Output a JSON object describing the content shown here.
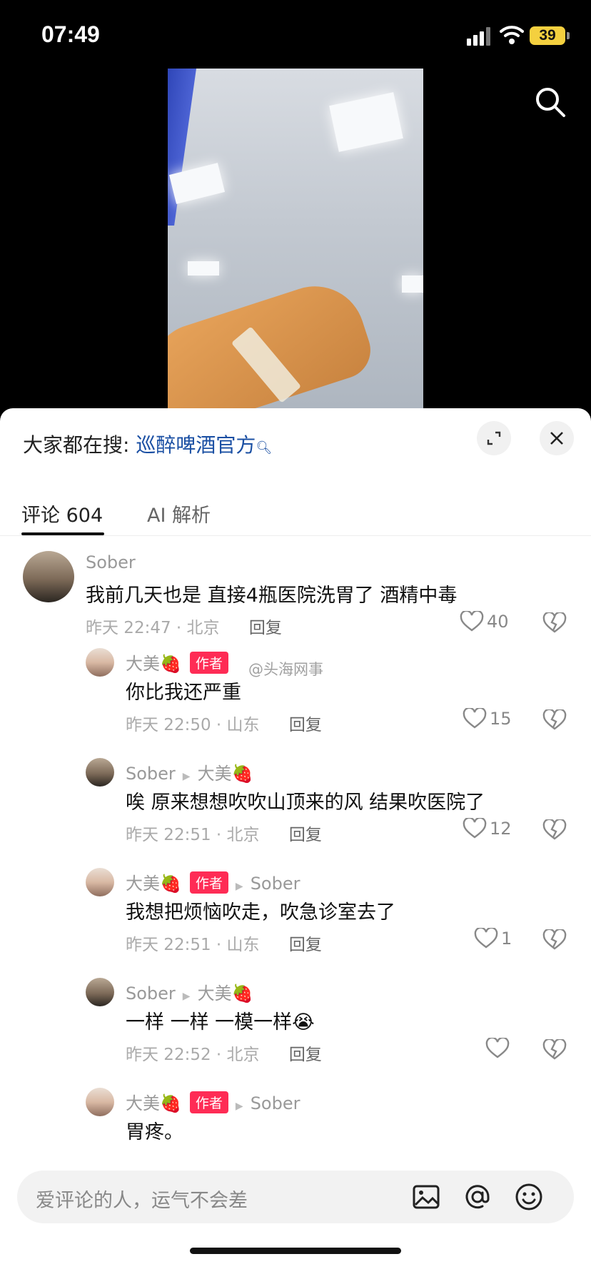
{
  "status_bar": {
    "time": "07:49",
    "battery": "39"
  },
  "hot_search": {
    "prefix": "大家都在搜:",
    "keyword": "巡醉啤酒官方"
  },
  "tabs": [
    {
      "label": "评论 604",
      "active": true
    },
    {
      "label": "AI 解析",
      "active": false
    }
  ],
  "watermark": "@头海网事",
  "comments": [
    {
      "user": "Sober",
      "reply_to": "",
      "is_author": false,
      "text": "我前几天也是 直接4瓶医院洗胃了 酒精中毒",
      "time": "昨天 22:47",
      "location": "北京",
      "reply_label": "回复",
      "likes": "40"
    },
    {
      "user": "大美🍓",
      "reply_to": "",
      "is_author": true,
      "text": "你比我还严重",
      "time": "昨天 22:50",
      "location": "山东",
      "reply_label": "回复",
      "likes": "15"
    },
    {
      "user": "Sober",
      "reply_to": "大美🍓",
      "is_author": false,
      "text": "唉 原来想想吹吹山顶来的风 结果吹医院了",
      "time": "昨天 22:51",
      "location": "北京",
      "reply_label": "回复",
      "likes": "12"
    },
    {
      "user": "大美🍓",
      "reply_to": "Sober",
      "is_author": true,
      "text": "我想把烦恼吹走，吹急诊室去了",
      "time": "昨天 22:51",
      "location": "山东",
      "reply_label": "回复",
      "likes": "1"
    },
    {
      "user": "Sober",
      "reply_to": "大美🍓",
      "is_author": false,
      "text": "一样 一样 一模一样😭",
      "time": "昨天 22:52",
      "location": "北京",
      "reply_label": "回复",
      "likes": ""
    },
    {
      "user": "大美🍓",
      "reply_to": "Sober",
      "is_author": true,
      "text": "胃疼。",
      "time": "",
      "location": "",
      "reply_label": "",
      "likes": ""
    }
  ],
  "author_badge": "作者",
  "input": {
    "placeholder": "爱评论的人，运气不会差"
  },
  "icons": [
    "search-icon",
    "expand-icon",
    "close-icon",
    "heart-icon",
    "broken-heart-icon",
    "image-icon",
    "at-icon",
    "emoji-icon"
  ]
}
